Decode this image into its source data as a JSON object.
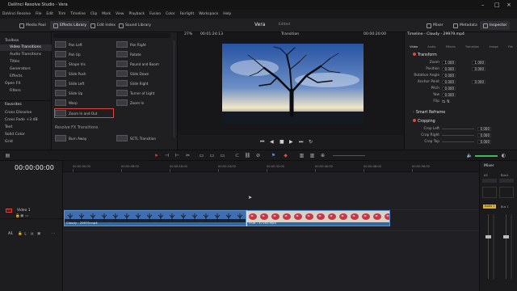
{
  "window": {
    "title": "DaVinci Resolve Studio - Vera"
  },
  "menu": [
    "DaVinci Resolve",
    "File",
    "Edit",
    "Trim",
    "Timeline",
    "Clip",
    "Mark",
    "View",
    "Playback",
    "Fusion",
    "Color",
    "Fairlight",
    "Workspace",
    "Help"
  ],
  "toolbar": {
    "media_pool": "Media Pool",
    "effects_library": "Effects Library",
    "edit_index": "Edit Index",
    "sound_library": "Sound Library",
    "project_name": "Vera",
    "project_status": "Edited",
    "mixer": "Mixer",
    "metadata": "Metadata",
    "inspector": "Inspector"
  },
  "left_panel": {
    "toolbox": "Toolbox",
    "items": [
      "Video Transitions",
      "Audio Transitions",
      "Titles",
      "Generators",
      "Effects"
    ],
    "open_fx": "Open FX",
    "filters": "Filters",
    "favorites": "Favorites",
    "fav_items": [
      "Cross Dissolve",
      "Cross Fade +3 dB",
      "Text",
      "Solid Color",
      "Grid"
    ]
  },
  "effects": {
    "items_left": [
      "Pan Left",
      "Pan Up",
      "Shape Iris",
      "Slide Push",
      "Slide Left",
      "Slide Up",
      "Warp",
      "Zoom In and Out"
    ],
    "items_right": [
      "Pan Right",
      "Rotate",
      "Round and Boom",
      "Slide Down",
      "Slide Right",
      "Turner of Light",
      "Zoom In",
      ""
    ],
    "section": "Resolve FX Transitions",
    "fx_items": [
      "Burn Away",
      "SCTL Transition"
    ]
  },
  "viewer": {
    "zoom": "27%",
    "timecode_left": "00:01:24:13",
    "mode": "Transition",
    "timecode_right": "00:00:20:00"
  },
  "inspector": {
    "title": "Timeline - Cloudy - 29979.mp4",
    "tabs": [
      "Video",
      "Audio",
      "Effects",
      "Transition",
      "Image",
      "File"
    ],
    "section_transform": "Transform",
    "rows": [
      {
        "label": "Zoom",
        "x": "1.000",
        "y": "1.000"
      },
      {
        "label": "Position",
        "x": "0.000",
        "y": "0.000"
      },
      {
        "label": "Rotation Angle",
        "x": "0.000",
        "y": ""
      },
      {
        "label": "Anchor Point",
        "x": "0.000",
        "y": "0.000"
      },
      {
        "label": "Pitch",
        "x": "0.000",
        "y": ""
      },
      {
        "label": "Yaw",
        "x": "0.000",
        "y": ""
      },
      {
        "label": "Flip",
        "x": "",
        "y": ""
      }
    ],
    "smart_reframe": "Smart Reframe",
    "section_cropping": "Cropping",
    "crop_rows": [
      {
        "label": "Crop Left",
        "value": "0.000"
      },
      {
        "label": "Crop Right",
        "value": "0.000"
      },
      {
        "label": "Crop Top",
        "value": "0.000"
      }
    ]
  },
  "timeline": {
    "timecode": "00:00:00:00",
    "ruler": [
      "00:00:00:00",
      "00:00:08:00",
      "00:00:16:00",
      "00:00:24:00",
      "00:00:32:00",
      "00:00:40:00",
      "00:00:48:00",
      "00:00:56:00"
    ],
    "video_track": "Video 1",
    "v_label": "V1",
    "a_label": "A1",
    "clips": [
      {
        "name": "Cloudy - 29979.mp4"
      },
      {
        "name": "Fruit - 47163.mp4"
      }
    ]
  },
  "mixer": {
    "title": "Mixer",
    "a1": "A1",
    "bus1": "Bus1",
    "audio1": "Audio 1",
    "bus1b": "Bus 1"
  },
  "colors": {
    "accent": "#d84a3f",
    "clip": "#2f6aa6",
    "playhead": "#d84a3f"
  }
}
